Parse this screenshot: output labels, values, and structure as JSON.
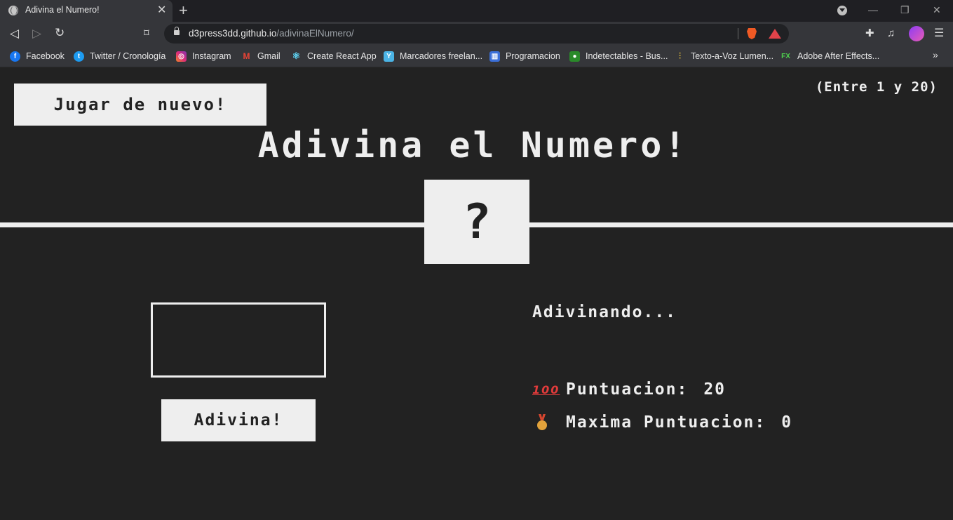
{
  "browser": {
    "tab_title": "Adivina el Numero!",
    "new_tab": "+",
    "url_host": "d3press3dd.github.io",
    "url_path": "/adivinaElNumero/",
    "window_controls": {
      "minimize": "—",
      "restore": "❐",
      "close": "✕"
    },
    "icons": [
      "back-icon",
      "forward-icon",
      "reload-icon",
      "bookmark-icon",
      "lock-icon",
      "brave-shield-icon",
      "brave-rewards-icon",
      "extensions-icon",
      "media-icon",
      "profile-avatar",
      "menu-icon"
    ],
    "bookmarks": [
      {
        "label": "Facebook",
        "icon_color": "#1877f2",
        "glyph": "f"
      },
      {
        "label": "Twitter / Cronología",
        "icon_color": "#1d9bf0",
        "glyph": "t"
      },
      {
        "label": "Instagram",
        "icon_color": "#d6249f",
        "glyph": "◎"
      },
      {
        "label": "Gmail",
        "icon_color": "#ea4335",
        "glyph": "M"
      },
      {
        "label": "Create React App",
        "icon_color": "#35363a",
        "glyph": "⚛"
      },
      {
        "label": "Marcadores freelan...",
        "icon_color": "#4bb4e6",
        "glyph": "Y"
      },
      {
        "label": "Programacion",
        "icon_color": "#3b6fd8",
        "glyph": "▥"
      },
      {
        "label": "Indetectables - Bus...",
        "icon_color": "#2a8a2a",
        "glyph": "●"
      },
      {
        "label": "Texto-a-Voz Lumen...",
        "icon_color": "#35363a",
        "glyph": "⫶"
      },
      {
        "label": "Adobe After Effects...",
        "icon_color": "#35363a",
        "glyph": "FX"
      }
    ],
    "more": "»"
  },
  "game": {
    "again_label": "Jugar de nuevo!",
    "range_label": "(Entre 1 y 20)",
    "title": "Adivina el Numero!",
    "secret_display": "?",
    "guess_value": "",
    "guess_button": "Adivina!",
    "message": "Adivinando...",
    "score_label": "Puntuacion:",
    "score_value": "20",
    "highscore_label": "Maxima Puntuacion:",
    "highscore_value": "0",
    "score_emoji": "100",
    "highscore_icon": "medal-icon"
  },
  "colors": {
    "background": "#222222",
    "foreground": "#eeeeee"
  }
}
